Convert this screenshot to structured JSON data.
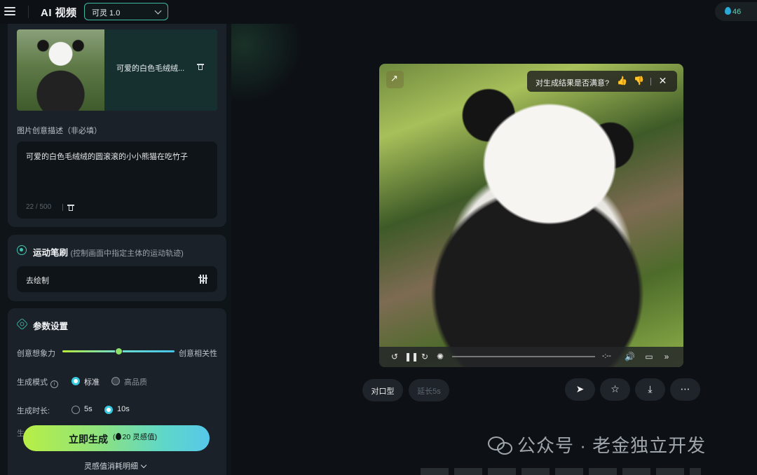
{
  "header": {
    "app_title": "AI 视频",
    "model": "可灵 1.0",
    "credits": "46"
  },
  "image_card": {
    "image_label": "可爱的白色毛绒绒...",
    "desc_label": "图片创意描述（非必填）",
    "desc_text": "可爱的白色毛绒绒的圆滚滚的小小熊猫在吃竹子",
    "desc_count": "22 / 500"
  },
  "motion_brush": {
    "title": "运动笔刷",
    "subtitle": "(控制画面中指定主体的运动轨迹)",
    "draw_label": "去绘制"
  },
  "params": {
    "title": "参数设置",
    "creativity_left": "创意想象力",
    "creativity_right": "创意相关性",
    "creativity_value": 0.5,
    "mode_label": "生成模式",
    "mode_options": [
      "标准",
      "高品质"
    ],
    "mode_selected": "标准",
    "duration_label": "生成时长:",
    "duration_options": [
      "5s",
      "10s"
    ],
    "duration_selected": "10s",
    "peek_label": "生"
  },
  "generate": {
    "label": "立即生成",
    "cost": "20 灵感值",
    "cost_link": "灵感值消耗明细"
  },
  "video": {
    "feedback_question": "对生成结果是否满意?",
    "timecode": "-:--"
  },
  "actions": {
    "lip_sync": "对口型",
    "extend": "延长5s"
  },
  "watermark": "公众号 · 老金独立开发",
  "icons": [
    "menu-icon",
    "chevron-down-icon",
    "flame-icon",
    "trash-icon",
    "brush-icon",
    "sliders-icon",
    "settings-icon",
    "info-icon",
    "expand-icon",
    "thumbs-up-icon",
    "thumbs-down-icon",
    "close-icon",
    "rewind-icon",
    "pause-icon",
    "forward-icon",
    "brightness-icon",
    "volume-icon",
    "airplay-icon",
    "next-icon",
    "send-icon",
    "star-icon",
    "download-icon",
    "more-icon",
    "wechat-icon"
  ],
  "colors": {
    "accent": "#37c9e0",
    "brand_green": "#b8ef45",
    "teal": "#3fc6b0"
  }
}
